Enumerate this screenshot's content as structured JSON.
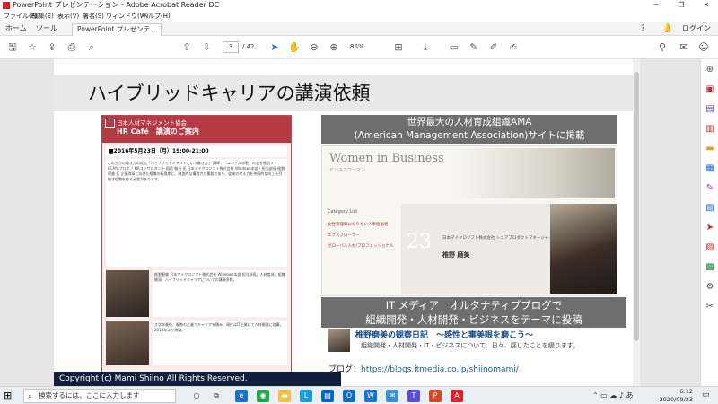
{
  "window": {
    "title": "PowerPoint プレゼンテーション - Adobe Acrobat Reader DC",
    "controls": [
      "─",
      "❐",
      "✕"
    ]
  },
  "menu": [
    "ファイル(F)",
    "編集(E)",
    "表示(V)",
    "署名(S)",
    "ウィンドウ(W)",
    "ヘルプ(H)"
  ],
  "tabs": {
    "home": "ホーム",
    "tools": "ツール",
    "document": "PowerPoint プレゼンテ... ×",
    "help": "?",
    "login": "ログイン"
  },
  "toolbar": {
    "current_page": "3",
    "total_pages": "/ 42",
    "zoom": "85%"
  },
  "slide": {
    "title": "ハイブリッドキャリアの講演依頼",
    "left_doc": {
      "org": "日本人材マネジメント協会",
      "event": "HR Café　講演のご案内",
      "date": "■2016年5月23日（月）19:00-21:00",
      "body": "これからの働き方の提言「ハイブリットキャリアという働き方」 講師：『エンゲル係数』の会社経営ＩＴ ECAYAプロボノ HRコンサルタント 稲荷 魁谷 氏 日本マイクロソフト株式会社 Windows本部・担当部長 椎野 磨美 氏 企業改革に向けた組織の転換期に、創造的な構造力が重要であり、従来の考え方を持続的な向上を目指す組織を作る必要があります。",
      "bio1": "椎野磨美 日本マイクロソフト株式会社 Windows本部 担当部長。人材育成、組織開発、ハイブリッドキャリアについての講演多数。",
      "bio2": "大学卒業後、複数の企業でキャリアを積み、現在はIT企業にて人材開発に従事。2016年より現職。"
    },
    "header1": {
      "line1": "世界最大の人材育成組織AMA",
      "line2": "(American Management Association)サイトに掲載"
    },
    "wib": {
      "title": "Women in Business",
      "subtitle": "ビジネスウーマン",
      "category": "Category List",
      "links": [
        "女性管理職になりたい人事担当者",
        "エクスプローラー",
        "グローバル人材/プロフェッショナル"
      ],
      "number": "23",
      "caption": "日本マイクロソフト株式会社 シニアプロダクトマネージャー",
      "name": "椎野 磨美"
    },
    "header2": {
      "line1": "IT メディア　オルタナティブブログで",
      "line2": "組織開発・人材開発・ビジネスをテーマに投稿"
    },
    "blog": {
      "title": "椎野磨美の観察日記　～感性と審美眼を磨こう～",
      "desc": "組織開発・人材開発・IT・ビジネスについて、日々、感じたことを綴ります。",
      "url_label": "ブログ：",
      "url": "https://blogs.itmedia.co.jp/shiinomami/"
    },
    "copyright": "Copyright (c)  Mami Shiino  All Rights Reserved."
  },
  "taskbar": {
    "search_placeholder": "検索するには、ここに入力します",
    "time": "6:12",
    "date": "2020/09/23"
  }
}
